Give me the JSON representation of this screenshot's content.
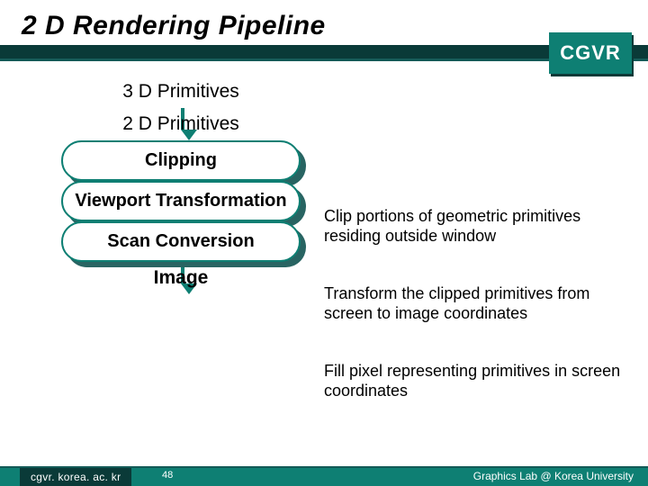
{
  "title": "2 D Rendering Pipeline",
  "brand": "CGVR",
  "flow": {
    "s1": "3 D Primitives",
    "s2": "2 D Primitives",
    "p1": "Clipping",
    "p2": "Viewport Transformation",
    "p3": "Scan Conversion",
    "out": "Image"
  },
  "desc": {
    "d1": "Clip portions of geometric primitives residing outside window",
    "d2": "Transform the clipped primitives from screen to image coordinates",
    "d3": "Fill pixel representing primitives in screen coordinates"
  },
  "footer": {
    "left": "cgvr. korea. ac. kr",
    "mid": "48",
    "right": "Graphics Lab @ Korea University"
  }
}
